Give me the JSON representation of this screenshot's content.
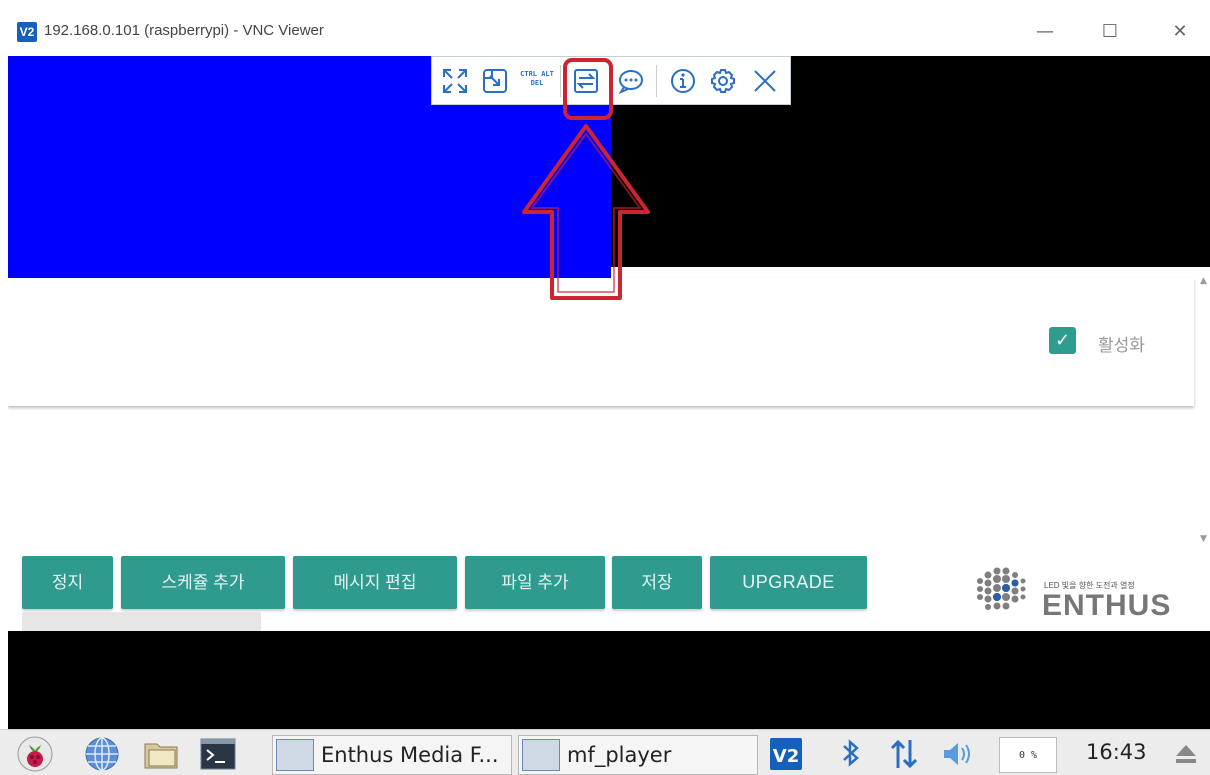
{
  "window": {
    "logo_text": "V2",
    "title": "192.168.0.101 (raspberrypi) - VNC Viewer",
    "minimize": "—",
    "maximize": "☐",
    "close": "✕"
  },
  "vnc_toolbar": {
    "icons": [
      "fullscreen-icon",
      "scale-icon",
      "ctrl-alt-del-icon",
      "transfer-icon",
      "chat-icon",
      "info-icon",
      "settings-icon",
      "close-icon"
    ],
    "ctrl_alt_del": "CTRL ALT DEL",
    "accent": "#2b6fc5"
  },
  "app": {
    "checkbox_label": "활성화",
    "checkbox_checked": true,
    "buttons": [
      "정지",
      "스케쥴 추가",
      "메시지 편집",
      "파일 추가",
      "저장",
      "UPGRADE"
    ],
    "button_color": "#2f9b8e",
    "logo": {
      "tagline": "LED 빛을 향한 도전과 열정",
      "name": "ENTHUS"
    }
  },
  "annotation": {
    "color": "#cc2430"
  },
  "taskbar": {
    "tasks": [
      "Enthus Media F...",
      "mf_player"
    ],
    "cpu": "0 %",
    "clock": "16:43"
  }
}
